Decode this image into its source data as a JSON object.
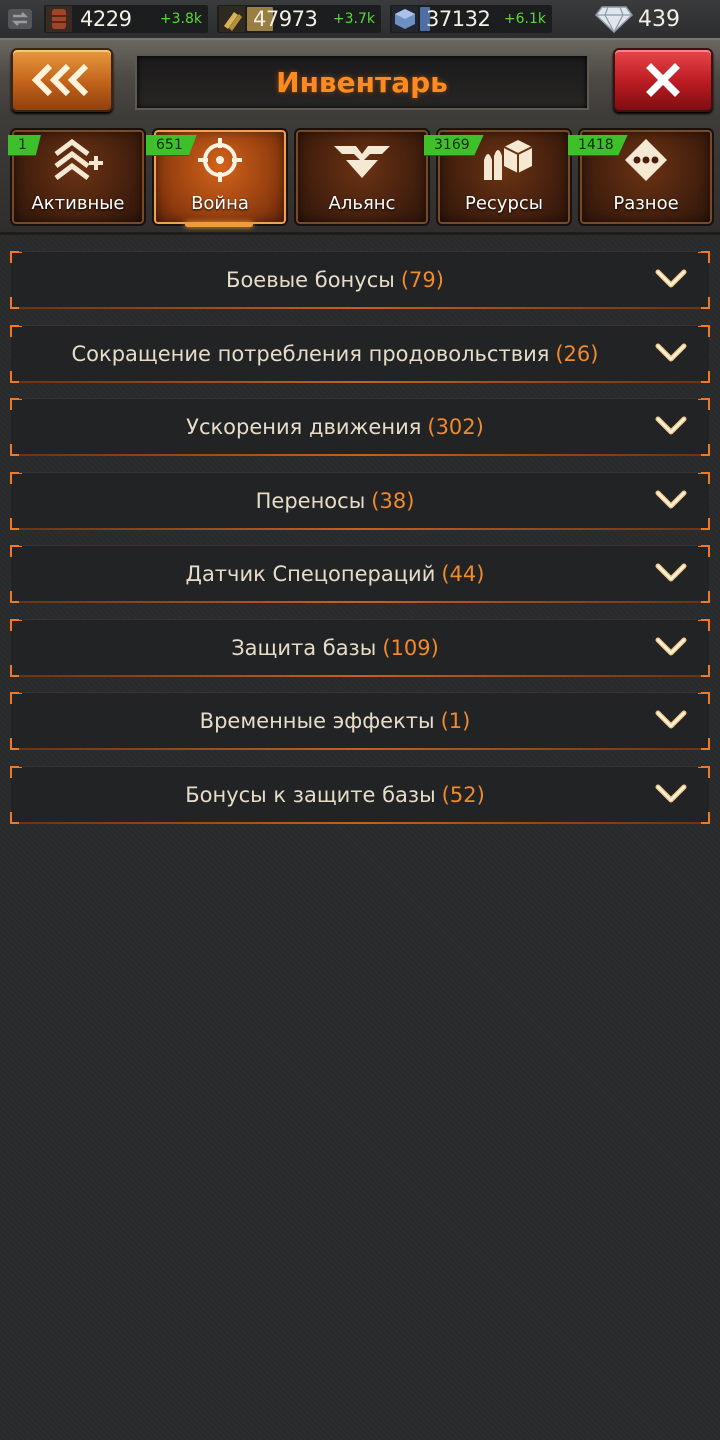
{
  "resources": [
    {
      "icon": "oil-barrel-icon",
      "value": "4229",
      "gain": "+3.8k",
      "fill": "#6a3a22"
    },
    {
      "icon": "ammo-icon",
      "value": "47973",
      "gain": "+3.7k",
      "fill": "#c2a050"
    },
    {
      "icon": "steel-cube-icon",
      "value": "37132",
      "gain": "+6.1k",
      "fill": "#5b7eb5"
    }
  ],
  "gems": {
    "icon": "diamond-icon",
    "value": "439"
  },
  "header": {
    "title": "Инвентарь"
  },
  "tabs": [
    {
      "label": "Активные",
      "count": "1",
      "icon": "rank-plus-icon",
      "active": false
    },
    {
      "label": "Война",
      "count": "651",
      "icon": "crosshair-icon",
      "active": true
    },
    {
      "label": "Альянс",
      "count": "",
      "icon": "alliance-wings-icon",
      "active": false
    },
    {
      "label": "Ресурсы",
      "count": "3169",
      "icon": "resources-icon",
      "active": false
    },
    {
      "label": "Разное",
      "count": "1418",
      "icon": "misc-dots-icon",
      "active": false
    }
  ],
  "categories": [
    {
      "name": "Боевые бонусы",
      "count": "(79)"
    },
    {
      "name": "Сокращение потребления продовольствия",
      "count": "(26)"
    },
    {
      "name": "Ускорения движения",
      "count": "(302)"
    },
    {
      "name": "Переносы",
      "count": "(38)"
    },
    {
      "name": "Датчик Спецопераций",
      "count": "(44)"
    },
    {
      "name": "Защита базы",
      "count": "(109)"
    },
    {
      "name": "Временные эффекты",
      "count": "(1)"
    },
    {
      "name": "Бонусы к защите базы",
      "count": "(52)"
    }
  ],
  "colors": {
    "accent": "#f07a24",
    "gain": "#5fd43a",
    "count_badge": "#3ec02a"
  }
}
